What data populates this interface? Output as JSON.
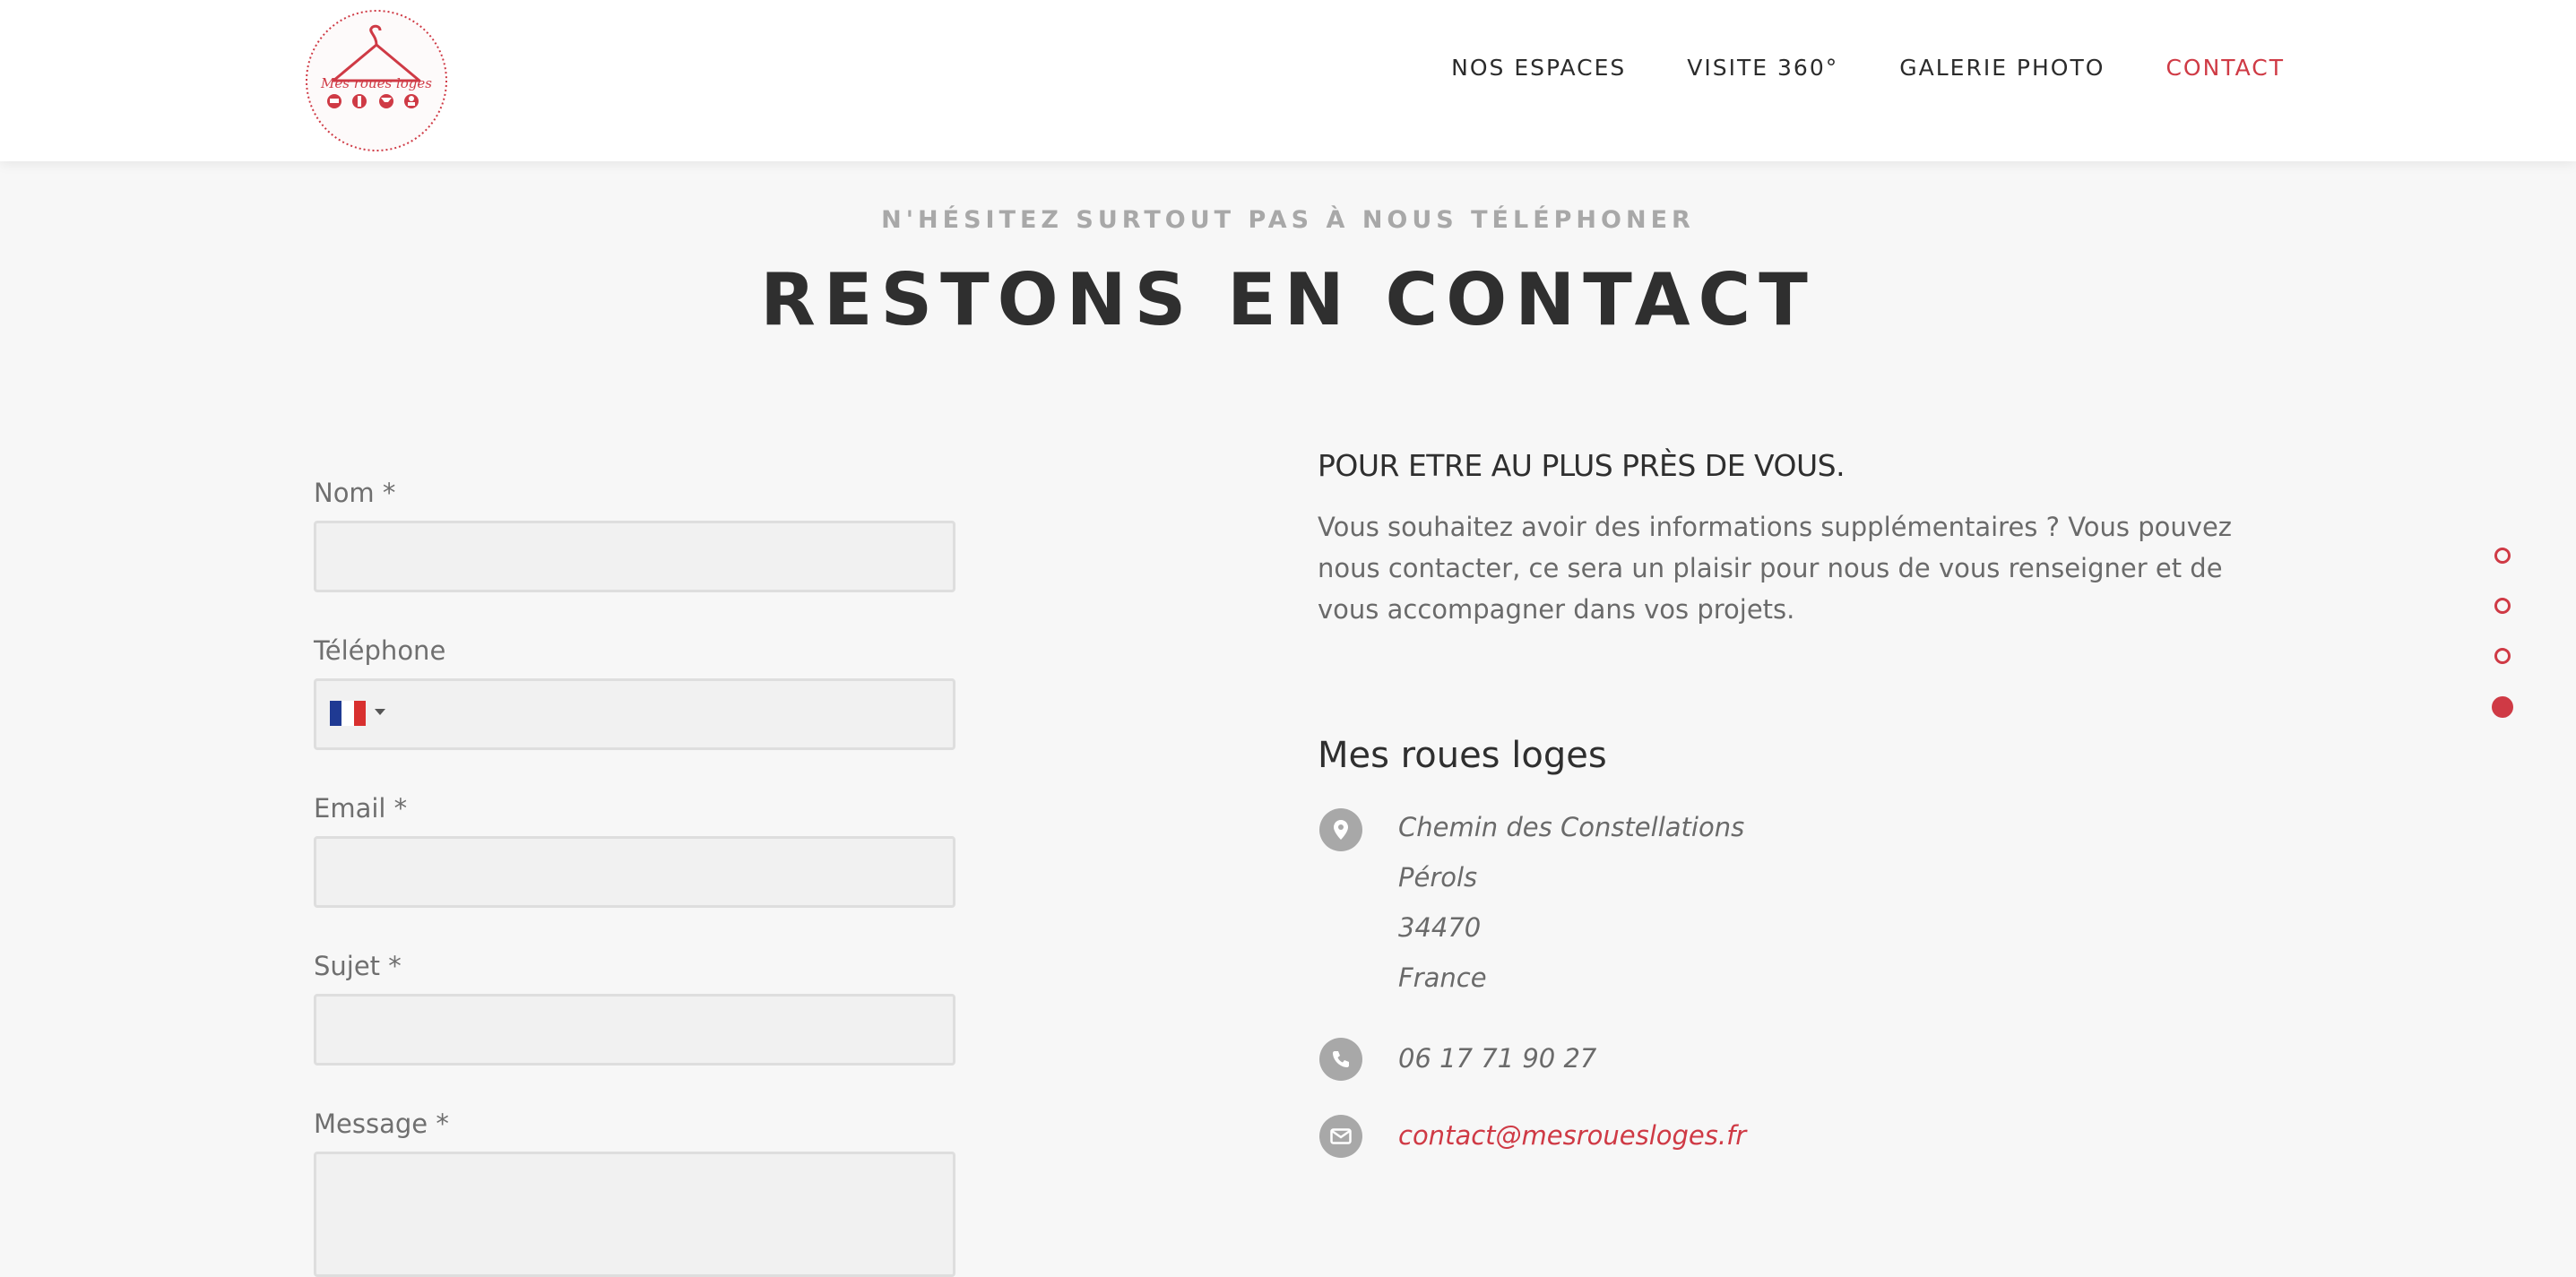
{
  "header": {
    "logo_text": "Mes roues loges",
    "nav": [
      {
        "label": "NOS ESPACES",
        "active": false
      },
      {
        "label": "VISITE 360°",
        "active": false
      },
      {
        "label": "GALERIE PHOTO",
        "active": false
      },
      {
        "label": "CONTACT",
        "active": true
      }
    ]
  },
  "section": {
    "kicker": "N'HÉSITEZ SURTOUT PAS À NOUS TÉLÉPHONER",
    "title": "RESTONS EN CONTACT"
  },
  "form": {
    "name_label": "Nom *",
    "name_value": "",
    "phone_label": "Téléphone",
    "phone_value": "",
    "phone_country": "FR",
    "email_label": "Email *",
    "email_value": "",
    "subject_label": "Sujet *",
    "subject_value": "",
    "message_label": "Message *",
    "message_value": ""
  },
  "info": {
    "heading": "POUR ETRE AU PLUS PRÈS DE VOUS.",
    "text": "Vous souhaitez avoir des informations supplémentaires ? Vous pouvez nous contacter, ce sera un plaisir pour nous de vous renseigner et de vous accompagner dans vos projets.",
    "company": "Mes roues loges",
    "address": [
      "Chemin des Constellations",
      "Pérols",
      "34470",
      "France"
    ],
    "phone": "06 17 71 90 27",
    "email": "contact@mesrouesloges.fr"
  },
  "colors": {
    "accent": "#cf3a45",
    "background": "#f7f7f7",
    "icon_bg": "#a8a8a8"
  },
  "side_dots": {
    "count": 4,
    "active_index": 3
  }
}
